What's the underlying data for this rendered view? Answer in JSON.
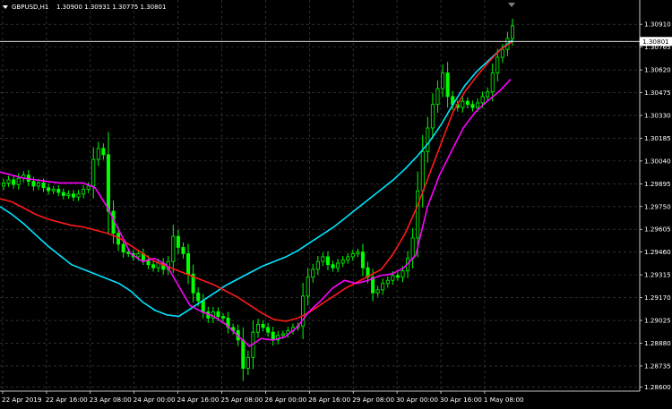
{
  "header": {
    "symbol_tf": "GBPUSD,H1",
    "ohlc": "1.30900 1.30931 1.30775 1.30801"
  },
  "price_tag": "1.30801",
  "colors": {
    "background": "#000000",
    "grid": "#4a4a4a",
    "candle": "#00ff00",
    "ma_fast": "#ff1a1a",
    "ma_upper": "#00e5ff",
    "ma_lower": "#ff00ff",
    "price_line": "#ffffff"
  },
  "chart_data": {
    "type": "candlestick",
    "ylim": [
      1.28575,
      1.30985
    ],
    "y_ticks": [
      "1.30910",
      "1.30765",
      "1.30620",
      "1.30475",
      "1.30330",
      "1.30185",
      "1.30040",
      "1.29895",
      "1.29750",
      "1.29605",
      "1.29460",
      "1.29315",
      "1.29170",
      "1.29025",
      "1.28880",
      "1.28735",
      "1.28600"
    ],
    "x_ticks": [
      "22 Apr 2019",
      "22 Apr 16:00",
      "23 Apr 08:00",
      "24 Apr 00:00",
      "24 Apr 16:00",
      "25 Apr 08:00",
      "26 Apr 00:00",
      "26 Apr 16:00",
      "29 Apr 08:00",
      "30 Apr 00:00",
      "30 Apr 16:00",
      "1 May 08:00"
    ],
    "last_price": 1.30801,
    "close_series": [
      1.299,
      1.2992,
      1.2989,
      1.2993,
      1.2995,
      1.2991,
      1.2988,
      1.299,
      1.2987,
      1.2985,
      1.2986,
      1.2984,
      1.2982,
      1.2983,
      1.2981,
      1.2983,
      1.2986,
      1.2988,
      1.3005,
      1.3012,
      1.3008,
      1.2972,
      1.2958,
      1.2951,
      1.2946,
      1.2945,
      1.2943,
      1.2945,
      1.2941,
      1.2938,
      1.2936,
      1.2939,
      1.2935,
      1.294,
      1.2956,
      1.2949,
      1.2945,
      1.2932,
      1.292,
      1.2915,
      1.2908,
      1.2904,
      1.2908,
      1.2905,
      1.2904,
      1.2898,
      1.2896,
      1.289,
      1.2872,
      1.2879,
      1.2895,
      1.29,
      1.2898,
      1.2895,
      1.289,
      1.2893,
      1.2894,
      1.2896,
      1.2898,
      1.2899,
      1.2918,
      1.293,
      1.2935,
      1.294,
      1.2943,
      1.2938,
      1.2936,
      1.2939,
      1.2941,
      1.2943,
      1.2945,
      1.2946,
      1.2936,
      1.293,
      1.292,
      1.2922,
      1.2926,
      1.2928,
      1.2931,
      1.293,
      1.2934,
      1.2942,
      1.2955,
      1.2985,
      1.301,
      1.3025,
      1.304,
      1.305,
      1.306,
      1.3045,
      1.304,
      1.3038,
      1.3042,
      1.304,
      1.3038,
      1.3041,
      1.3045,
      1.3048,
      1.306,
      1.307,
      1.3075,
      1.3082,
      1.309
    ],
    "ma_fast": [
      1.298,
      1.2978,
      1.2974,
      1.297,
      1.2967,
      1.2965,
      1.2963,
      1.2962,
      1.296,
      1.2958,
      1.2955,
      1.295,
      1.2945,
      1.294,
      1.2937,
      1.2934,
      1.2931,
      1.2928,
      1.2925,
      1.2921,
      1.2917,
      1.2912,
      1.2907,
      1.2903,
      1.2902,
      1.2904,
      1.2908,
      1.2913,
      1.2918,
      1.2923,
      1.2927,
      1.2931,
      1.2935,
      1.2945,
      1.2958,
      1.2975,
      1.2995,
      1.3015,
      1.3035,
      1.3048,
      1.3058,
      1.3067,
      1.3075,
      1.308
    ],
    "ma_upper": [
      1.2975,
      1.297,
      1.2964,
      1.2957,
      1.295,
      1.2944,
      1.2938,
      1.2935,
      1.2932,
      1.2929,
      1.2926,
      1.2921,
      1.2914,
      1.2909,
      1.2906,
      1.2905,
      1.291,
      1.2915,
      1.292,
      1.2925,
      1.2929,
      1.2933,
      1.2937,
      1.294,
      1.2943,
      1.2947,
      1.2952,
      1.2957,
      1.2962,
      1.2968,
      1.2974,
      1.298,
      1.2986,
      1.2992,
      1.2999,
      1.3007,
      1.3016,
      1.3027,
      1.304,
      1.3052,
      1.3061,
      1.3068,
      1.3075,
      1.3081
    ],
    "ma_lower": [
      1.2997,
      1.2995,
      1.2993,
      1.2992,
      1.2991,
      1.299,
      1.299,
      1.299,
      1.2987,
      1.2975,
      1.296,
      1.2945,
      1.294,
      1.2942,
      1.2938,
      1.2925,
      1.2912,
      1.2908,
      1.2905,
      1.29,
      1.2893,
      1.2886,
      1.2891,
      1.289,
      1.2892,
      1.2898,
      1.2908,
      1.2915,
      1.2923,
      1.2928,
      1.2926,
      1.2928,
      1.2931,
      1.2932,
      1.2936,
      1.2944,
      1.2975,
      1.2995,
      1.301,
      1.3025,
      1.3035,
      1.3042,
      1.3048,
      1.3056
    ]
  }
}
